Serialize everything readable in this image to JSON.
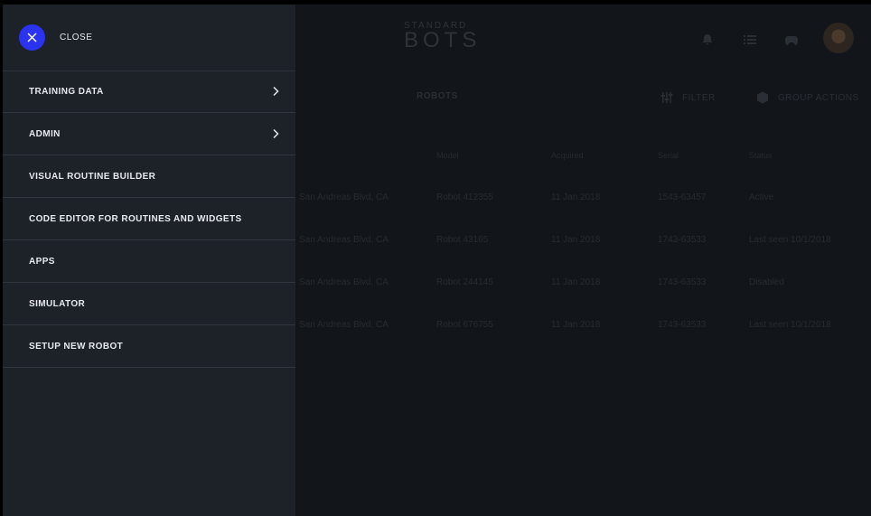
{
  "header": {
    "logo_top": "STANDARD",
    "logo_main": "BOTS",
    "icons": [
      "bell-icon",
      "list-icon",
      "controller-icon"
    ]
  },
  "toolbar": {
    "tab_robots": "ROBOTS",
    "filter_label": "FILTER",
    "group_actions_label": "GROUP ACTIONS"
  },
  "table": {
    "columns": [
      "Model",
      "Acquired",
      "Serial",
      "Status"
    ],
    "rows": [
      {
        "location": "San Andreas Blvd, CA",
        "model": "Robot 412355",
        "acquired": "11 Jan 2018",
        "serial": "1543-63457",
        "status": "Active"
      },
      {
        "location": "San Andreas Blvd, CA",
        "model": "Robot 43165",
        "acquired": "11 Jan 2018",
        "serial": "1743-63533",
        "status": "Last seen 10/1/2018"
      },
      {
        "location": "San Andreas Blvd, CA",
        "model": "Robot 244145",
        "acquired": "11 Jan 2018",
        "serial": "1743-63533",
        "status": "Disabled"
      },
      {
        "location": "San Andreas Blvd, CA",
        "model": "Robot 676755",
        "acquired": "11 Jan 2018",
        "serial": "1743-63533",
        "status": "Last seen 10/1/2018"
      }
    ]
  },
  "menu": {
    "close_label": "CLOSE",
    "items": [
      {
        "label": "TRAINING DATA",
        "has_submenu": true
      },
      {
        "label": "ADMIN",
        "has_submenu": true
      },
      {
        "label": "VISUAL ROUTINE BUILDER",
        "has_submenu": false
      },
      {
        "label": "CODE EDITOR FOR ROUTINES AND WIDGETS",
        "has_submenu": false
      },
      {
        "label": "APPS",
        "has_submenu": false
      },
      {
        "label": "SIMULATOR",
        "has_submenu": false
      },
      {
        "label": "SETUP NEW ROBOT",
        "has_submenu": false
      }
    ]
  },
  "colors": {
    "accent": "#2933f0",
    "drawer_bg": "#1d2228",
    "page_bg": "#121519"
  }
}
